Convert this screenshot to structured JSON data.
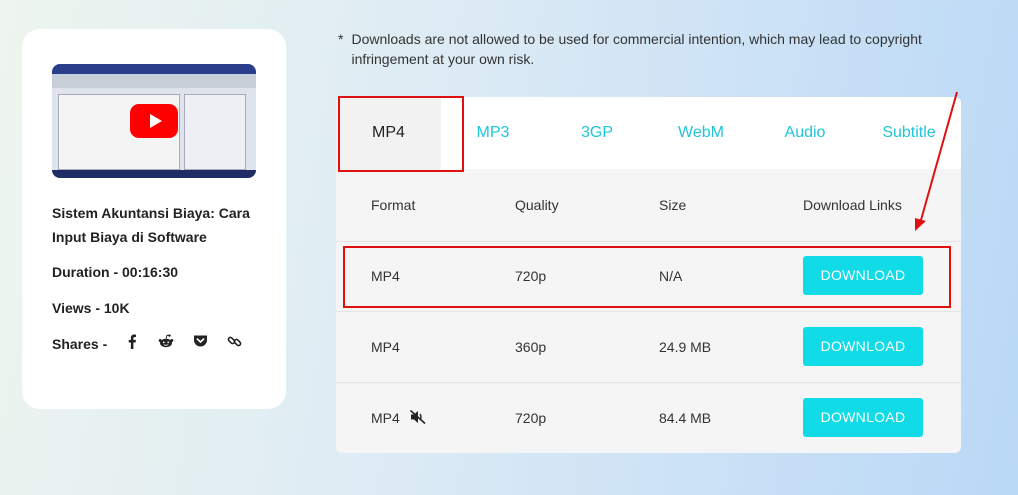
{
  "video": {
    "title": "Sistem Akuntansi Biaya: Cara Input Biaya di Software",
    "duration": "Duration -  00:16:30",
    "views": "Views - 10K",
    "shares_label": "Shares -",
    "share_icons": [
      "facebook-icon",
      "reddit-icon",
      "pocket-icon",
      "link-icon"
    ]
  },
  "notice": {
    "bullet": "*",
    "text": "Downloads are not allowed to be used for commercial intention, which may lead to copyright infringement at your own risk."
  },
  "tabs": [
    "MP4",
    "MP3",
    "3GP",
    "WebM",
    "Audio",
    "Subtitle"
  ],
  "active_tab": "MP4",
  "table": {
    "headers": [
      "Format",
      "Quality",
      "Size",
      "Download Links"
    ],
    "rows": [
      {
        "format": "MP4",
        "quality": "720p",
        "size": "N/A",
        "button": "DOWNLOAD",
        "muted": false
      },
      {
        "format": "MP4",
        "quality": "360p",
        "size": "24.9 MB",
        "button": "DOWNLOAD",
        "muted": false
      },
      {
        "format": "MP4",
        "quality": "720p",
        "size": "84.4 MB",
        "button": "DOWNLOAD",
        "muted": true
      }
    ]
  },
  "colors": {
    "accent": "#12dbe8",
    "tab_text": "#1fc5d9",
    "highlight": "#e01010",
    "youtube": "#ff0000"
  }
}
